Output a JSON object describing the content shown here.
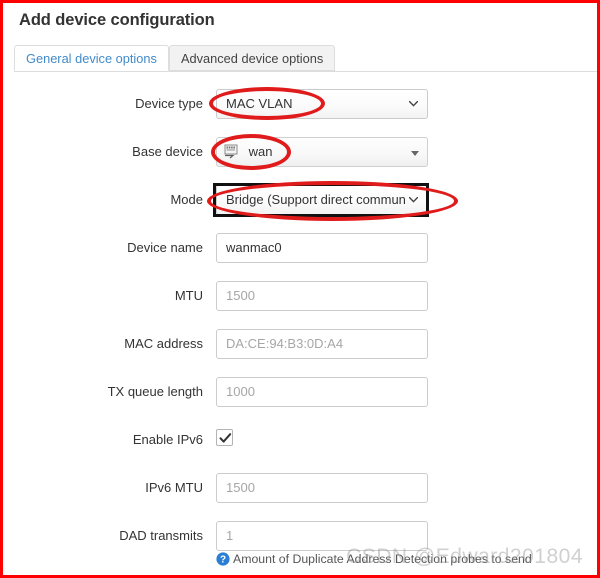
{
  "window": {
    "title": "Add device configuration",
    "frame_color": "#fe0000"
  },
  "tabs": [
    {
      "label": "General device options",
      "active": true
    },
    {
      "label": "Advanced device options",
      "active": false
    }
  ],
  "form": {
    "device_type": {
      "label": "Device type",
      "value": "MAC VLAN",
      "control": "select",
      "annotation": "red-ellipse"
    },
    "base_device": {
      "label": "Base device",
      "value": "wan",
      "icon": "network-adapter-icon",
      "control": "combobox",
      "annotation": "red-ellipse"
    },
    "mode": {
      "label": "Mode",
      "value": "Bridge (Support direct commun",
      "control": "select",
      "annotation": "black-rect-and-red-ellipse"
    },
    "device_name": {
      "label": "Device name",
      "value": "wanmac0",
      "is_placeholder": false
    },
    "mtu": {
      "label": "MTU",
      "value": "1500",
      "is_placeholder": true
    },
    "mac_address": {
      "label": "MAC address",
      "value": "DA:CE:94:B3:0D:A4",
      "is_placeholder": true
    },
    "tx_queue_length": {
      "label": "TX queue length",
      "value": "1000",
      "is_placeholder": true
    },
    "enable_ipv6": {
      "label": "Enable IPv6",
      "checked": true
    },
    "ipv6_mtu": {
      "label": "IPv6 MTU",
      "value": "1500",
      "is_placeholder": true
    },
    "dad_transmits": {
      "label": "DAD transmits",
      "value": "1",
      "is_placeholder": true,
      "help_text": "Amount of Duplicate Address Detection probes to send",
      "help_icon": "question-circle-icon"
    }
  },
  "watermark": {
    "text": "CSDN @Edward201804"
  },
  "colors": {
    "tab_active_text": "#428bca",
    "annotation_red": "#e01b1b",
    "annotation_black": "#111111",
    "placeholder_text": "#a6a6a6"
  }
}
